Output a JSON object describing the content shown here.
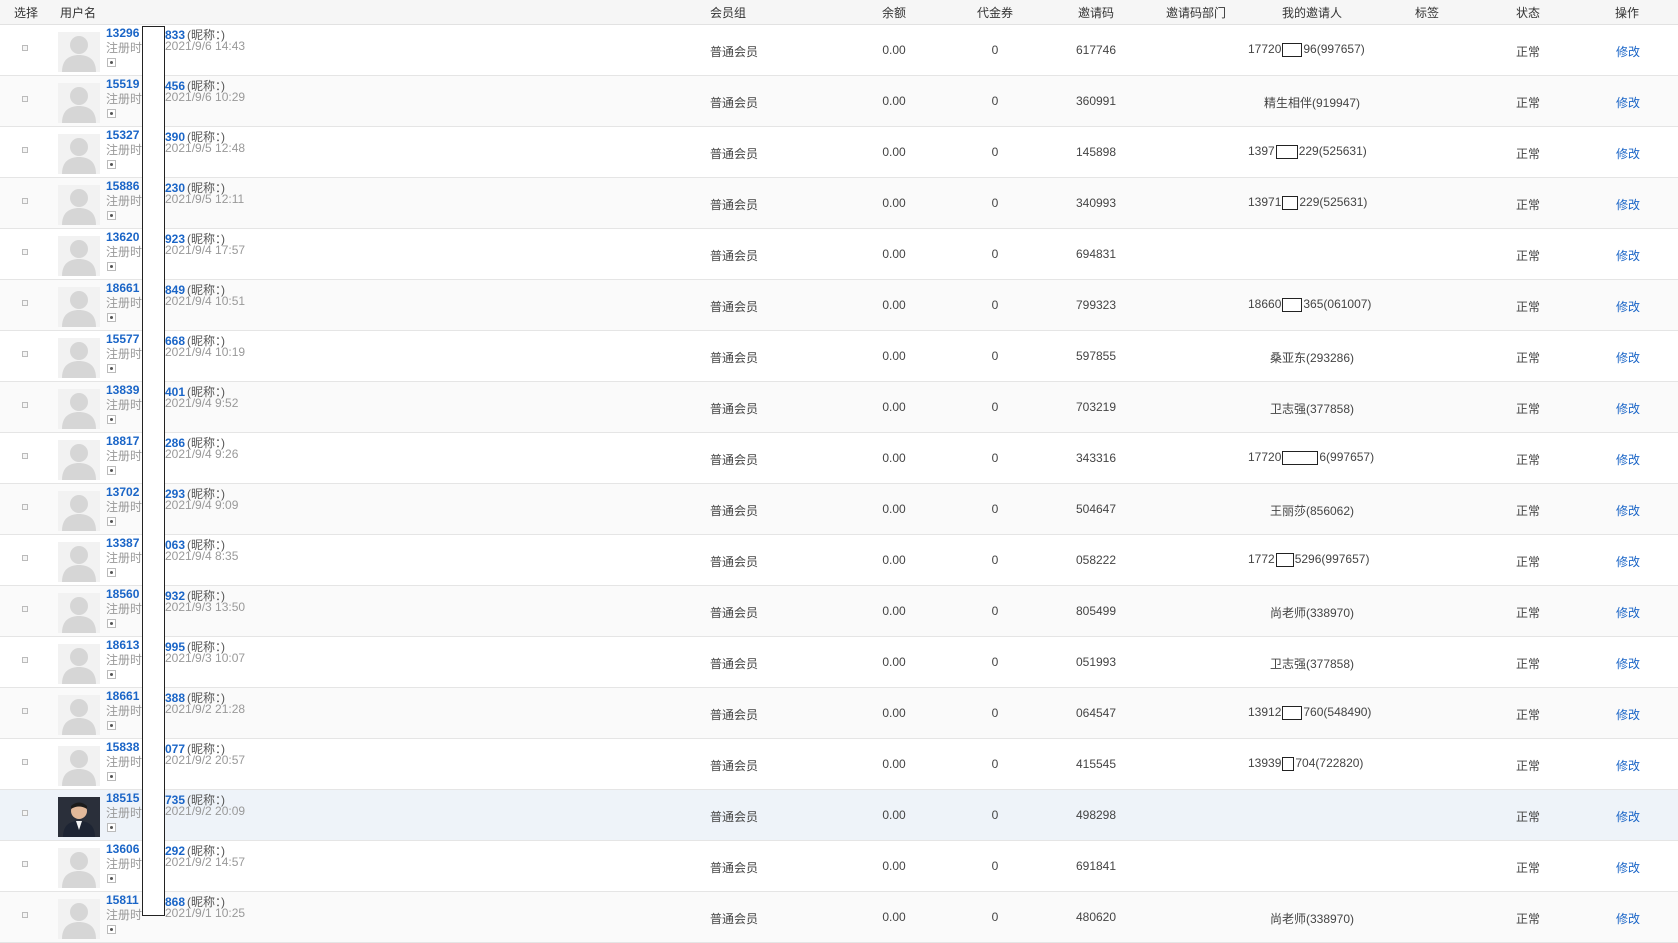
{
  "header": {
    "select": "选择",
    "username": "用户名",
    "group": "会员组",
    "balance": "余额",
    "voucher": "代金券",
    "invite_code": "邀请码",
    "invite_dept": "邀请码部门",
    "my_inviter": "我的邀请人",
    "tag": "标签",
    "status": "状态",
    "action": "操作"
  },
  "labels": {
    "nickname": "(昵称：)",
    "reg_label": "注册时",
    "group_value": "普通会员",
    "balance_value": "0.00",
    "voucher_value": "0",
    "status_value": "正常",
    "edit": "修改"
  },
  "rows": [
    {
      "u1": "13296",
      "u2": "833",
      "time": "2021/9/6 14:43",
      "code": "617746",
      "inv_a": "17720",
      "inv_b": "96(997657)"
    },
    {
      "u1": "15519",
      "u2": "456",
      "time": "2021/9/6 10:29",
      "code": "360991",
      "inviter": "精生相伴(919947)"
    },
    {
      "u1": "15327",
      "u2": "390",
      "time": "2021/9/5 12:48",
      "code": "145898",
      "inv_a": "1397",
      "inv_b": "229(525631)"
    },
    {
      "u1": "15886",
      "u2": "230",
      "time": "2021/9/5 12:11",
      "code": "340993",
      "inv_a": "13971",
      "inv_b": "229(525631)"
    },
    {
      "u1": "13620",
      "u2": "923",
      "time": "2021/9/4 17:57",
      "code": "694831",
      "inviter": ""
    },
    {
      "u1": "18661",
      "u2": "849",
      "time": "2021/9/4 10:51",
      "code": "799323",
      "inv_a": "18660",
      "inv_b": "365(061007)"
    },
    {
      "u1": "15577",
      "u2": "668",
      "time": "2021/9/4 10:19",
      "code": "597855",
      "inviter": "桑亚东(293286)"
    },
    {
      "u1": "13839",
      "u2": "401",
      "time": "2021/9/4 9:52",
      "code": "703219",
      "inviter": "卫志强(377858)"
    },
    {
      "u1": "18817",
      "u2": "286",
      "time": "2021/9/4 9:26",
      "code": "343316",
      "inv_a": "17720",
      "inv_b": "6(997657)"
    },
    {
      "u1": "13702",
      "u2": "293",
      "time": "2021/9/4 9:09",
      "code": "504647",
      "inviter": "王丽莎(856062)"
    },
    {
      "u1": "13387",
      "u2": "063",
      "time": "2021/9/4 8:35",
      "code": "058222",
      "inv_a": "1772",
      "inv_b": "5296(997657)"
    },
    {
      "u1": "18560",
      "u2": "932",
      "time": "2021/9/3 13:50",
      "code": "805499",
      "inviter": "尚老师(338970)"
    },
    {
      "u1": "18613",
      "u2": "995",
      "time": "2021/9/3 10:07",
      "code": "051993",
      "inviter": "卫志强(377858)"
    },
    {
      "u1": "18661",
      "u2": "388",
      "time": "2021/9/2 21:28",
      "code": "064547",
      "inv_a": "13912",
      "inv_b": "760(548490)"
    },
    {
      "u1": "15838",
      "u2": "077",
      "time": "2021/9/2 20:57",
      "code": "415545",
      "inv_a": "13939",
      "inv_b": "704(722820)"
    },
    {
      "u1": "18515",
      "u2": "735",
      "time": "2021/9/2 20:09",
      "code": "498298",
      "inviter": "",
      "photo": true
    },
    {
      "u1": "13606",
      "u2": "292",
      "time": "2021/9/2 14:57",
      "code": "691841",
      "inviter": ""
    },
    {
      "u1": "15811",
      "u2": "868",
      "time": "2021/9/1 10:25",
      "code": "480620",
      "inviter": "尚老师(338970)"
    }
  ],
  "icons": {
    "avatar_placeholder": "user-silhouette-icon",
    "row_indicator": "radio-dot-icon"
  },
  "colors": {
    "link": "#1a65c7",
    "header_bg": "#f6f6f6",
    "row_highlight": "#eef3f9"
  }
}
